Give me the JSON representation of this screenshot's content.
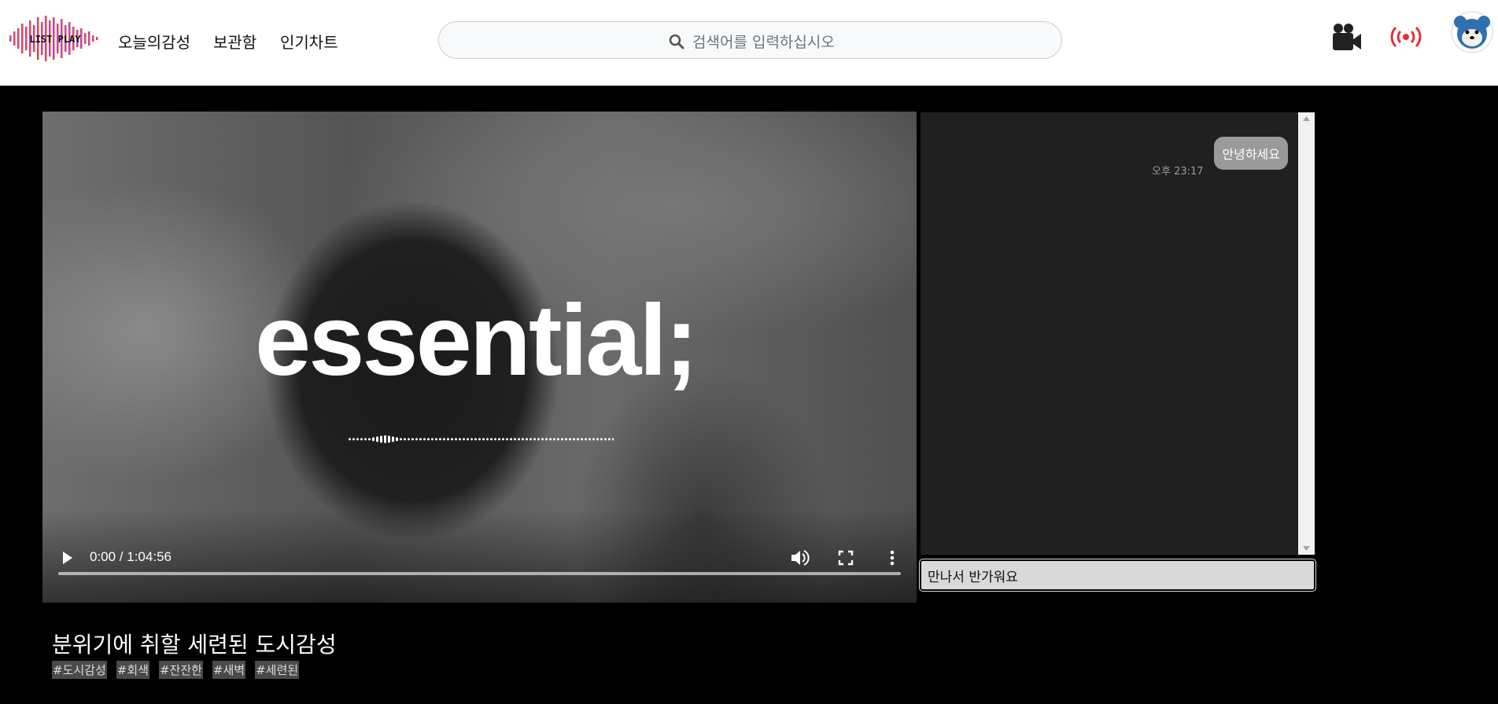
{
  "header": {
    "logo_text": "LIST PLAY",
    "nav": [
      "오늘의감성",
      "보관함",
      "인기차트"
    ],
    "search": {
      "placeholder": "검색어를 입력하십시오"
    },
    "icons": [
      "video-camera-icon",
      "broadcast-icon",
      "avatar-icon"
    ],
    "accent_color": "#e0323a"
  },
  "video": {
    "overlay_title": "essential;",
    "time": "0:00 / 1:04:56",
    "progress": 0,
    "icons": [
      "play-icon",
      "volume-icon",
      "fullscreen-icon",
      "more-icon"
    ]
  },
  "chat": {
    "messages": [
      {
        "text": "안녕하세요",
        "meridiem": "오후",
        "time": "23:17"
      }
    ],
    "input_value": "만나서 반가워요"
  },
  "content": {
    "title": "분위기에 취할 세련된 도시감성",
    "tags": [
      "#도시감성",
      "#회색",
      "#잔잔한",
      "#새벽",
      "#세련된"
    ]
  }
}
